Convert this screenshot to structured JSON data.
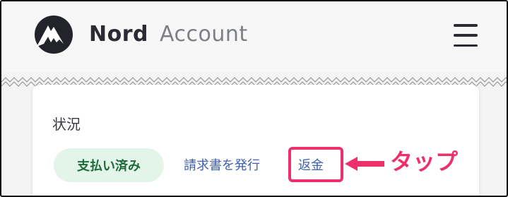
{
  "header": {
    "brand_primary": "Nord",
    "brand_secondary": "Account",
    "logo_icon": "nord-mountain-icon",
    "menu_icon": "hamburger-menu-icon"
  },
  "card": {
    "status_label": "状況",
    "paid_badge": "支払い済み",
    "invoice_link": "請求書を発行",
    "refund_link": "返金"
  },
  "annotation": {
    "text": "タップ",
    "color": "#ef2f6c"
  },
  "colors": {
    "link": "#3e5fb5",
    "badge_bg": "#e3f4e8",
    "badge_text": "#1f6a3a",
    "brand_dark": "#2b2b33"
  }
}
